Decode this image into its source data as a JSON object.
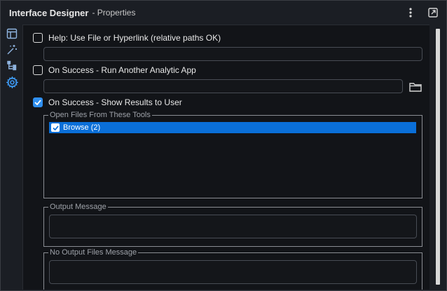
{
  "titlebar": {
    "title": "Interface Designer",
    "subtitle": "- Properties",
    "menu_icon": "vertical-ellipsis-icon",
    "popout_icon": "popout-icon"
  },
  "sidebar": {
    "items": [
      {
        "name": "layout",
        "icon": "layout-icon"
      },
      {
        "name": "test",
        "icon": "magic-wand-icon"
      },
      {
        "name": "tree",
        "icon": "tree-icon"
      },
      {
        "name": "properties",
        "icon": "gear-icon",
        "active": true
      }
    ]
  },
  "options": {
    "help": {
      "label": "Help: Use File or Hyperlink (relative paths OK)",
      "checked": false,
      "value": ""
    },
    "run_app": {
      "label": "On Success - Run Another Analytic App",
      "checked": false,
      "value": ""
    },
    "show_results": {
      "label": "On Success - Show Results to User",
      "checked": true
    }
  },
  "open_files": {
    "legend": "Open Files From These Tools",
    "items": [
      {
        "label": "Browse (2)",
        "checked": true,
        "selected": true
      }
    ]
  },
  "output_message": {
    "legend": "Output Message",
    "value": ""
  },
  "no_output_message": {
    "legend": "No Output Files Message",
    "value": ""
  },
  "colors": {
    "accent": "#2f8ff0",
    "selection": "#0a6fd8",
    "background": "#121418"
  }
}
